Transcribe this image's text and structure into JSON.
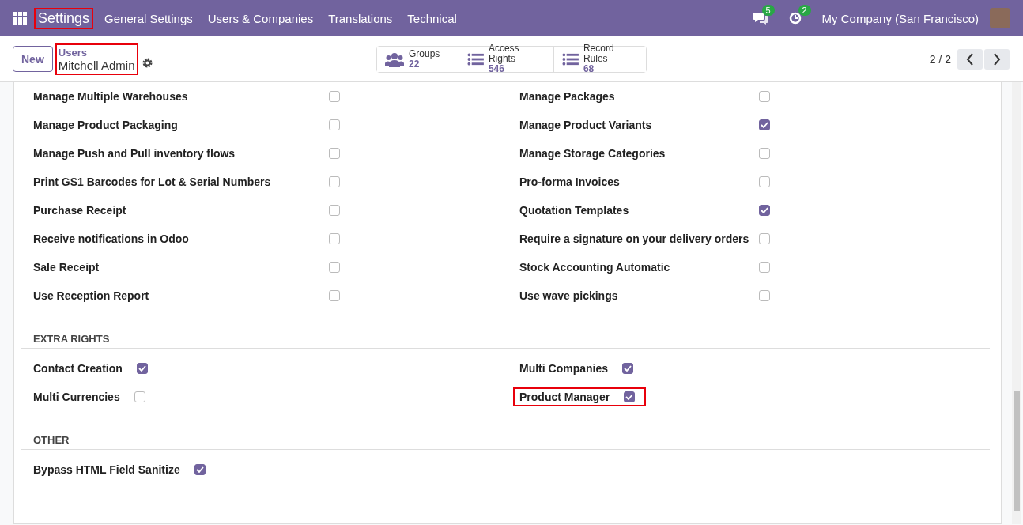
{
  "navbar": {
    "brand": {
      "label": "Settings",
      "highlighted": true
    },
    "menu": [
      "General Settings",
      "Users & Companies",
      "Translations",
      "Technical"
    ],
    "messages_badge": "5",
    "activities_badge": "2",
    "company": "My Company (San Francisco)"
  },
  "control_panel": {
    "new_button": "New",
    "breadcrumb": {
      "parent": "Users",
      "current": "Mitchell Admin",
      "highlighted": true
    },
    "smart_buttons": [
      {
        "kind": "groups",
        "label": "Groups",
        "value": "22"
      },
      {
        "kind": "list",
        "label": "Access Rights",
        "value": "546"
      },
      {
        "kind": "list",
        "label": "Record Rules",
        "value": "68"
      }
    ],
    "pager": "2 / 2"
  },
  "sections": [
    {
      "kind": "grid",
      "items": [
        {
          "label": "Manage Multiple Warehouses",
          "checked": false,
          "highlighted": false
        },
        {
          "label": "Manage Packages",
          "checked": false,
          "highlighted": false
        },
        {
          "label": "Manage Product Packaging",
          "checked": false,
          "highlighted": false
        },
        {
          "label": "Manage Product Variants",
          "checked": true,
          "highlighted": false
        },
        {
          "label": "Manage Push and Pull inventory flows",
          "checked": false,
          "highlighted": false
        },
        {
          "label": "Manage Storage Categories",
          "checked": false,
          "highlighted": false
        },
        {
          "label": "Print GS1 Barcodes for Lot & Serial Numbers",
          "checked": false,
          "highlighted": false
        },
        {
          "label": "Pro-forma Invoices",
          "checked": false,
          "highlighted": false
        },
        {
          "label": "Purchase Receipt",
          "checked": false,
          "highlighted": false
        },
        {
          "label": "Quotation Templates",
          "checked": true,
          "highlighted": false
        },
        {
          "label": "Receive notifications in Odoo",
          "checked": false,
          "highlighted": false
        },
        {
          "label": "Require a signature on your delivery orders",
          "checked": false,
          "highlighted": false
        },
        {
          "label": "Sale Receipt",
          "checked": false,
          "highlighted": false
        },
        {
          "label": "Stock Accounting Automatic",
          "checked": false,
          "highlighted": false
        },
        {
          "label": "Use Reception Report",
          "checked": false,
          "highlighted": false
        },
        {
          "label": "Use wave pickings",
          "checked": false,
          "highlighted": false
        }
      ]
    },
    {
      "kind": "inline",
      "title": "EXTRA RIGHTS",
      "items": [
        {
          "label": "Contact Creation",
          "checked": true,
          "highlighted": false
        },
        {
          "label": "Multi Companies",
          "checked": true,
          "highlighted": false
        },
        {
          "label": "Multi Currencies",
          "checked": false,
          "highlighted": false
        },
        {
          "label": "Product Manager",
          "checked": true,
          "highlighted": true
        }
      ]
    },
    {
      "kind": "inline",
      "title": "OTHER",
      "items": [
        {
          "label": "Bypass HTML Field Sanitize",
          "checked": true,
          "highlighted": false
        }
      ]
    }
  ]
}
